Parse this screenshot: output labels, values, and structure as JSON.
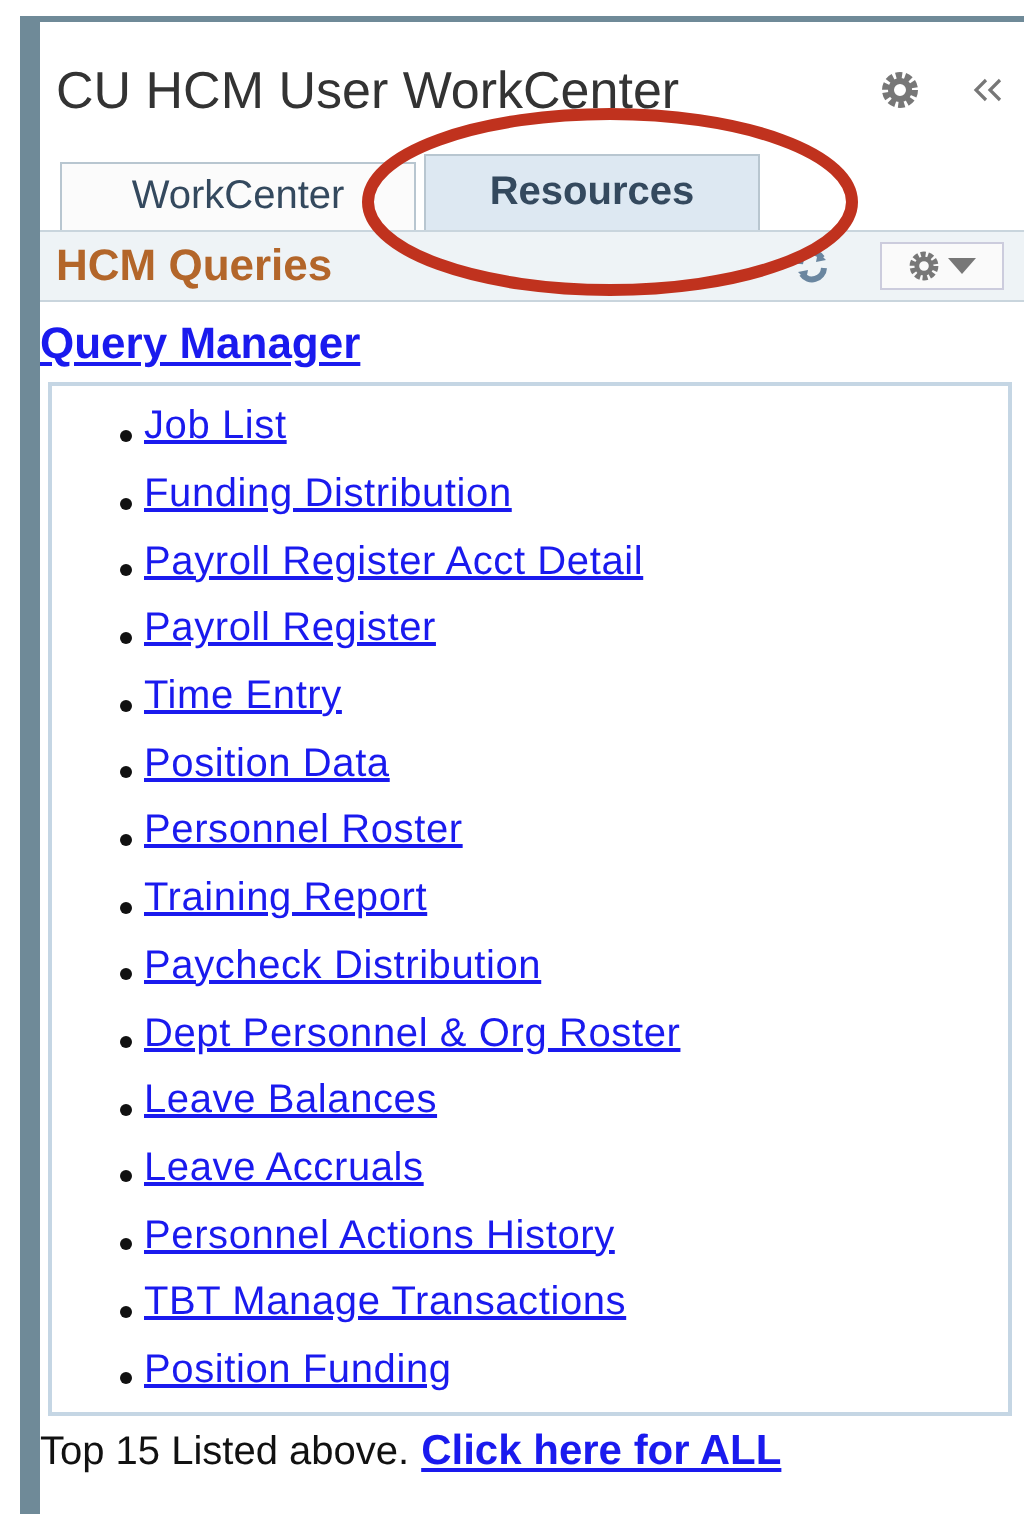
{
  "title": "CU HCM User WorkCenter",
  "tabs": [
    {
      "label": "WorkCenter",
      "selected": false
    },
    {
      "label": "Resources",
      "selected": true
    }
  ],
  "section": {
    "title": "HCM Queries"
  },
  "query_manager": "Query Manager",
  "queries": [
    "Job List",
    "Funding Distribution",
    "Payroll Register Acct Detail",
    "Payroll Register",
    "Time Entry",
    "Position Data",
    "Personnel Roster",
    "Training Report",
    "Paycheck Distribution",
    "Dept Personnel & Org Roster",
    "Leave Balances",
    "Leave Accruals",
    "Personnel Actions History",
    "TBT Manage Transactions",
    "Position Funding"
  ],
  "footer": {
    "text": "Top 15 Listed above.",
    "link": "Click here for ALL"
  }
}
